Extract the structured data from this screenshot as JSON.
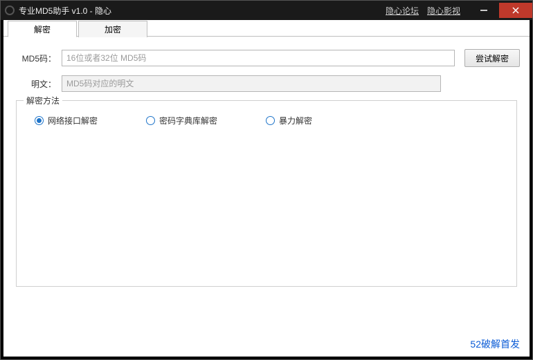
{
  "titlebar": {
    "title": "专业MD5助手 v1.0 - 隐心",
    "link_forum": "隐心论坛",
    "link_video": "隐心影视"
  },
  "tabs": {
    "decrypt": "解密",
    "encrypt": "加密"
  },
  "form": {
    "md5_label": "MD5码：",
    "md5_placeholder": "16位或者32位 MD5码",
    "try_button": "尝试解密",
    "plain_label": "明文：",
    "plain_placeholder": "MD5码对应的明文"
  },
  "methods": {
    "legend": "解密方法",
    "opt_network": "网络接口解密",
    "opt_dict": "密码字典库解密",
    "opt_brute": "暴力解密",
    "selected": "network"
  },
  "footer": {
    "credit": "52破解首发"
  }
}
